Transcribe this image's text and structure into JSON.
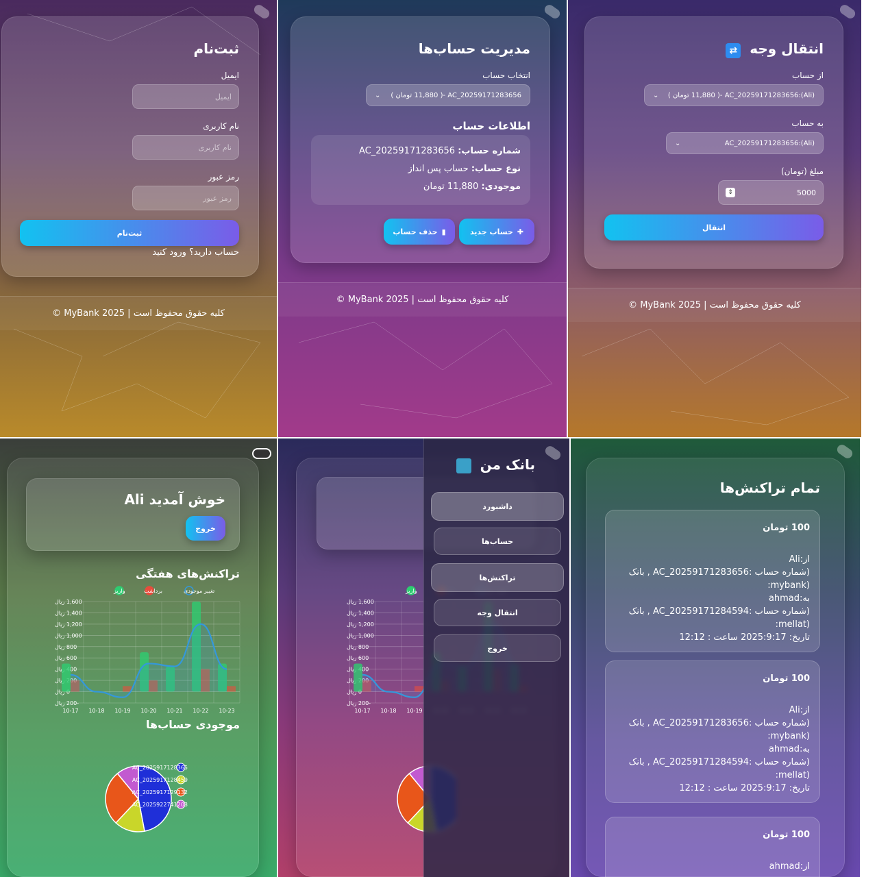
{
  "register": {
    "title": "ثبت‌نام",
    "email_label": "ایمیل",
    "email_placeholder": "ایمیل",
    "username_label": "نام کاربری",
    "username_placeholder": "نام کاربری",
    "password_label": "رمز عبور",
    "password_placeholder": "رمز عبور",
    "submit_label": "ثبت‌نام",
    "login_link": "حساب دارید؟ ورود کنید"
  },
  "footer_text": "© MyBank 2025 | کلیه حقوق محفوظ است",
  "accounts": {
    "title": "مدیریت حساب‌ها",
    "select_label": "انتخاب حساب",
    "selected_account": "AC_20259171283656 -( 11,880 تومان )",
    "info_title": "اطلاعات حساب",
    "number_label": "شماره حساب:",
    "number_value": "AC_20259171283656",
    "type_label": "نوع حساب:",
    "type_value": "حساب پس انداز",
    "balance_label": "موجودی:",
    "balance_value": "11,880 تومان",
    "new_button": "حساب جدید",
    "delete_button": "حذف حساب"
  },
  "transfer": {
    "title": "انتقال وجه",
    "from_label": "از حساب",
    "from_value": "AC_20259171283656:(Ali) -( 11,880 تومان )",
    "to_label": "به حساب",
    "to_value": "AC_20259171283656:(Ali)",
    "amount_label": "مبلغ (تومان)",
    "amount_value": "5000",
    "submit_label": "انتقال"
  },
  "dashboard": {
    "welcome": "خوش آمدید Ali",
    "logout_button": "خروج",
    "weekly_title": "تراکنش‌های هفتگی",
    "balances_title": "موجودی حساب‌ها"
  },
  "sidebar": {
    "title": "بانک من",
    "items": [
      "داشبورد",
      "حساب‌ها",
      "تراکنش‌ها",
      "انتقال وجه",
      "خروج"
    ]
  },
  "transactions": {
    "title": "تمام تراکنش‌ها",
    "items": [
      {
        "amount": "100 تومان",
        "lines": [
          "از:Ali",
          "(شماره حساب :AC_20259171283656 , بانک",
          "(mybank:",
          "به:ahmad",
          "(شماره حساب :AC_20259171284594 , بانک",
          "(mellat:",
          "تاریخ: 2025:9:17 ساعت : 12:12"
        ]
      },
      {
        "amount": "100 تومان",
        "lines": [
          "از:Ali",
          "(شماره حساب :AC_20259171283656 , بانک",
          "(mybank:",
          "به:ahmad",
          "(شماره حساب :AC_20259171284594 , بانک",
          "(mellat:",
          "تاریخ: 2025:9:17 ساعت : 12:12"
        ]
      },
      {
        "amount": "100 تومان",
        "lines": [
          "از:ahmad"
        ]
      }
    ]
  },
  "chart_data": [
    {
      "type": "bar",
      "title": "تراکنش‌های هفتگی",
      "categories": [
        "10-17",
        "10-18",
        "10-19",
        "10-20",
        "10-21",
        "10-22",
        "10-23"
      ],
      "series": [
        {
          "name": "واریز",
          "color": "#2ecc71",
          "values": [
            500,
            0,
            0,
            700,
            450,
            1600,
            500
          ]
        },
        {
          "name": "برداشت",
          "color": "#e74c3c",
          "values": [
            200,
            0,
            100,
            200,
            0,
            400,
            100
          ]
        },
        {
          "name": "تغییر موجودی",
          "color": "#3498db",
          "type": "line",
          "values": [
            300,
            0,
            -100,
            500,
            450,
            1200,
            400
          ]
        }
      ],
      "y_tick_labels": [
        "1,600 ریال",
        "1,400 ریال",
        "1,200 ریال",
        "1,000 ریال",
        "800 ریال",
        "600 ریال",
        "400 ریال",
        "200 ریال",
        "0 ریال",
        "-200 ریال"
      ],
      "ylim": [
        -200,
        1600
      ],
      "legend": "top",
      "grid": true
    },
    {
      "type": "pie",
      "title": "موجودی حساب‌ها",
      "labels": [
        "AC_2025917128365",
        "AC_2025917128459",
        "AC_2025917129132",
        "AC_2025922741203"
      ],
      "colors": [
        "#1f2fd8",
        "#c9d62a",
        "#e8561a",
        "#c25ad0"
      ],
      "values": [
        47,
        15,
        27,
        11
      ],
      "legend": "right"
    }
  ],
  "colors": {
    "button_gradient_start": "#12c2f0",
    "button_gradient_end": "#7a5ce8",
    "deposit": "#2ecc71",
    "withdraw": "#e74c3c",
    "balance_change": "#3498db"
  }
}
